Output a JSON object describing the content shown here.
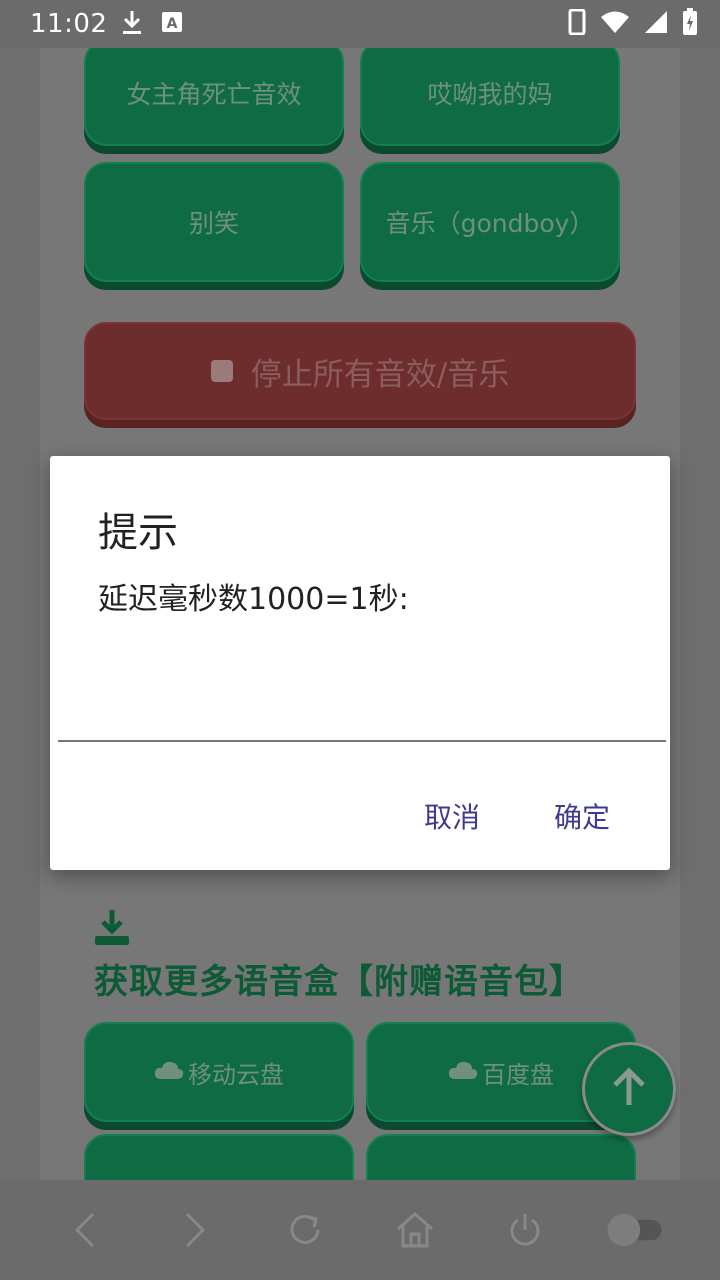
{
  "status_bar": {
    "time": "11:02",
    "icons": [
      "download-icon",
      "font-a-icon",
      "phone-icon",
      "wifi-icon",
      "signal-icon",
      "battery-charging-icon"
    ]
  },
  "sound_buttons": [
    {
      "label": "女主角死亡音效"
    },
    {
      "label": "哎呦我的妈"
    },
    {
      "label": "别笑"
    },
    {
      "label": "音乐（gondboy）"
    }
  ],
  "stop_button": {
    "label": "停止所有音效/音乐"
  },
  "more_section": {
    "title": "获取更多语音盒【附赠语音包】",
    "links": [
      {
        "label": "移动云盘"
      },
      {
        "label": "百度盘"
      }
    ]
  },
  "dialog": {
    "title": "提示",
    "message": "延迟毫秒数1000=1秒:",
    "input_value": "",
    "cancel_label": "取消",
    "ok_label": "确定"
  },
  "nav_icons": [
    "back-icon",
    "forward-icon",
    "refresh-icon",
    "home-icon",
    "power-icon",
    "toggle-icon"
  ],
  "colors": {
    "button_green": "#0f6b43",
    "stop_red": "#6e2d2d",
    "dialog_action": "#3e3a8f"
  }
}
